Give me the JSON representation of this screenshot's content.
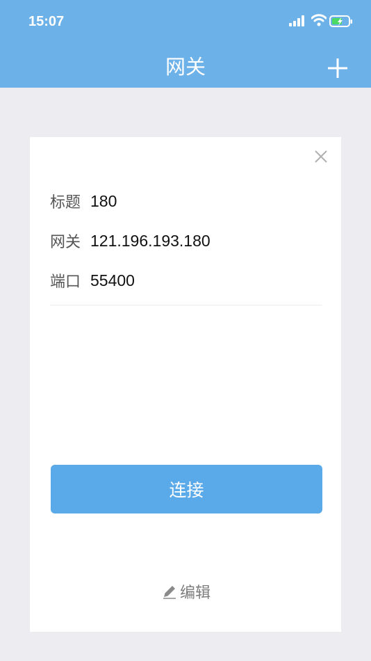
{
  "status_bar": {
    "time": "15:07",
    "icons": [
      "cellular-signal-icon",
      "wifi-icon",
      "battery-charging-icon"
    ]
  },
  "nav": {
    "title": "网关",
    "add_icon": "plus-icon"
  },
  "gateway_card": {
    "close_icon": "close-icon",
    "rows": [
      {
        "label": "标题",
        "value": "180"
      },
      {
        "label": "网关",
        "value": "121.196.193.180"
      },
      {
        "label": "端口",
        "value": "55400"
      }
    ],
    "connect_label": "连接",
    "edit_label": "编辑",
    "edit_icon": "pencil-icon"
  },
  "colors": {
    "header": "#6cb1e8",
    "button": "#5aa9e8",
    "background": "#ececf1",
    "battery": "#4cd964"
  }
}
